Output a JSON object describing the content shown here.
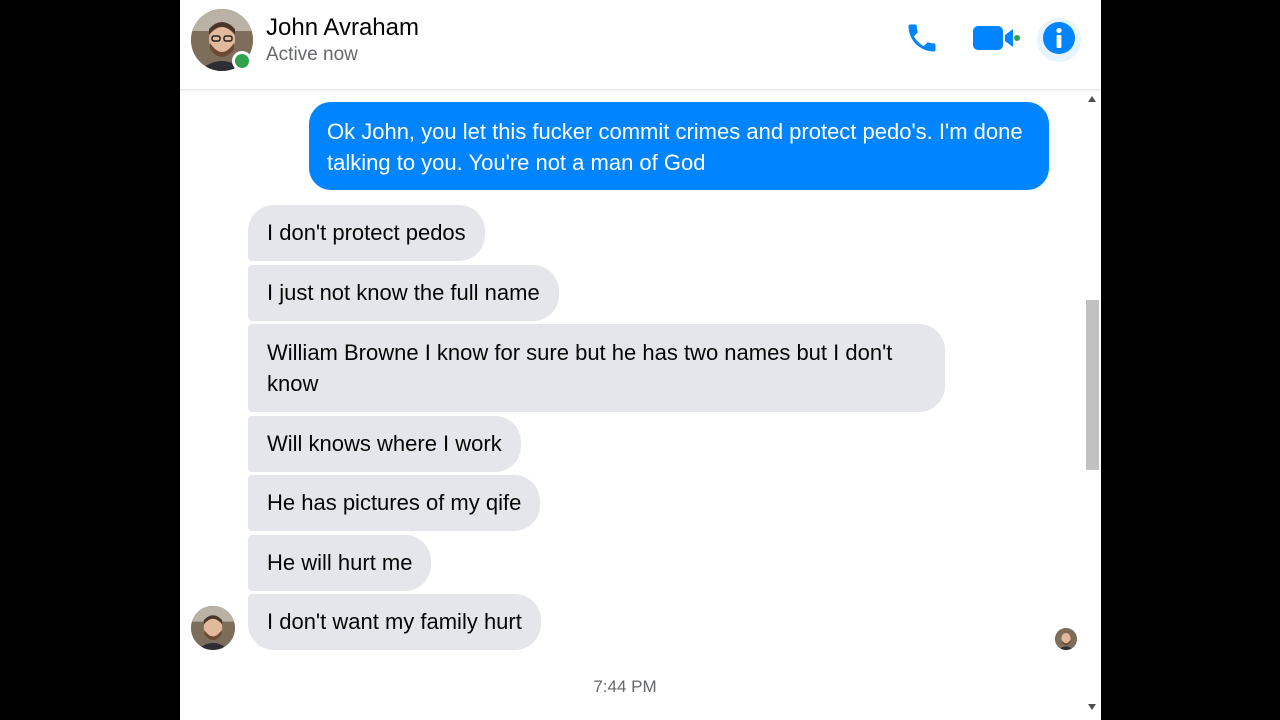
{
  "contact": {
    "name": "John Avraham",
    "status": "Active now"
  },
  "header_icons": [
    "phone-icon",
    "video-camera-icon",
    "info-icon"
  ],
  "colors": {
    "accent": "#0084ff",
    "incoming_bubble": "#e4e6eb",
    "online": "#31a24c"
  },
  "messages": [
    {
      "from": "me",
      "text": "Ok John, you let this fucker commit crimes and protect pedo's. I'm done talking to you. You're not a man of God"
    },
    {
      "from": "them",
      "text": "I don't protect pedos"
    },
    {
      "from": "them",
      "text": "I just not know the full name"
    },
    {
      "from": "them",
      "text": "William Browne I know for sure but he has two names but I don't know"
    },
    {
      "from": "them",
      "text": "Will knows where I work"
    },
    {
      "from": "them",
      "text": "He has pictures of my qife"
    },
    {
      "from": "them",
      "text": "He will hurt me"
    },
    {
      "from": "them",
      "text": "I don't want my family hurt"
    }
  ],
  "timestamp": "7:44 PM"
}
